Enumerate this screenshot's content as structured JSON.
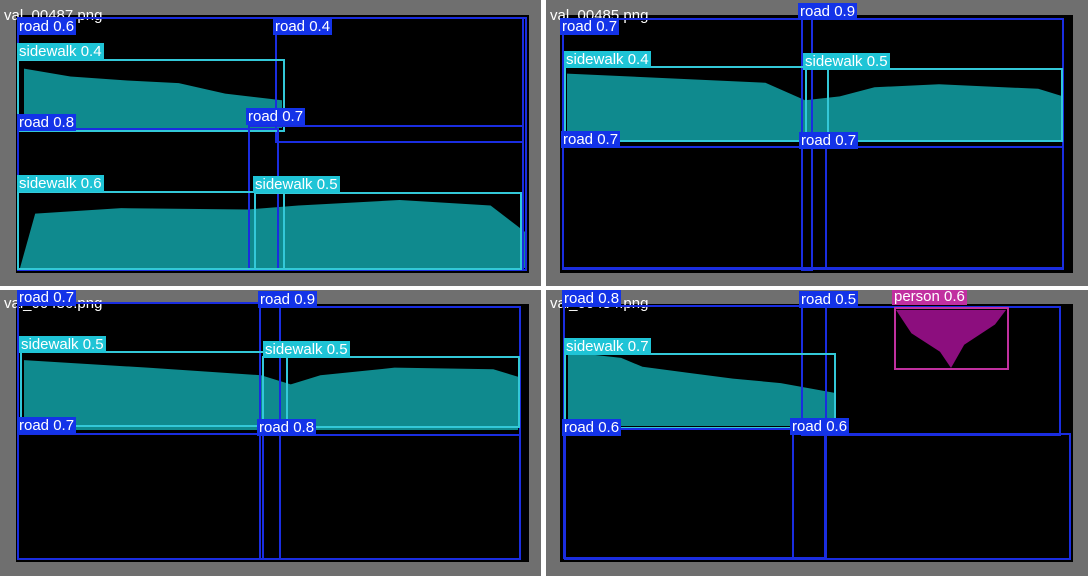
{
  "colors": {
    "road": "#1333e8",
    "sidewalk": "#1fc4d6",
    "person": "#c12fa0",
    "mask_sidewalk": "#0f8a8e",
    "mask_person": "#8c0e7e",
    "background": "#6f6f6f"
  },
  "panels": [
    {
      "filename": "val_00487.png",
      "labels": [
        "road 0.6",
        "road 0.4",
        "sidewalk 0.4",
        "road 0.8",
        "road 0.7",
        "sidewalk 0.6",
        "sidewalk 0.5"
      ]
    },
    {
      "filename": "val_00485.png",
      "labels": [
        "road 0.9",
        "road 0.7",
        "sidewalk 0.4",
        "sidewalk 0.5",
        "road 0.7",
        "road 0.7"
      ]
    },
    {
      "filename": "val_00486.png",
      "labels": [
        "road 0.7",
        "road 0.9",
        "sidewalk 0.5",
        "sidewalk 0.5",
        "road 0.7",
        "road 0.8"
      ]
    },
    {
      "filename": "val_00484.png",
      "labels": [
        "road 0.8",
        "road 0.5",
        "person 0.6",
        "sidewalk 0.7",
        "road 0.6",
        "road 0.6"
      ]
    }
  ]
}
